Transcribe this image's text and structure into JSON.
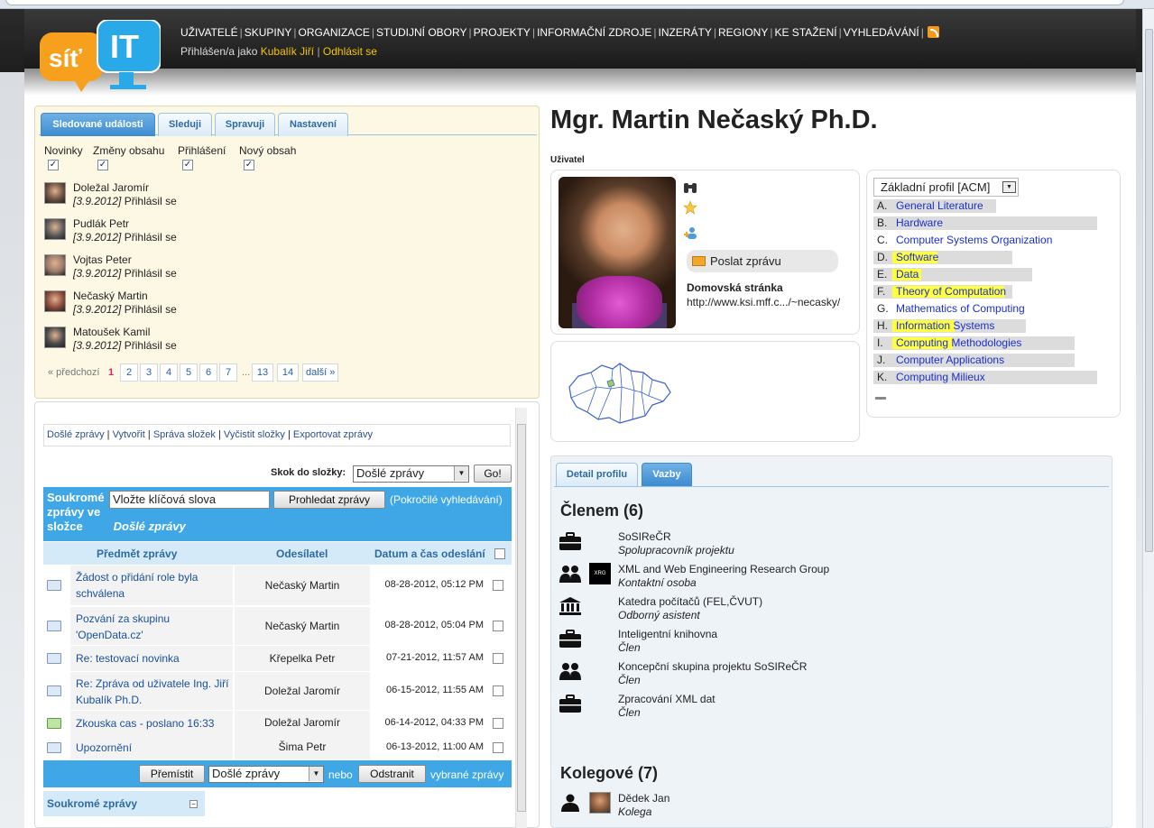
{
  "header": {
    "logo_text_left": "síť",
    "logo_text_right": "IT",
    "nav": [
      "UŽIVATELÉ",
      "SKUPINY",
      "ORGANIZACE",
      "STUDIJNÍ OBORY",
      "PROJEKTY",
      "INFORMAČNÍ ZDROJE",
      "INZERÁTY",
      "REGIONY",
      "KE STAŽENÍ",
      "VYHLEDÁVÁNÍ"
    ],
    "logged_prefix": "Přihlášen/a jako",
    "logged_user": "Kubalík Jiří",
    "logout": "Odhlásit se"
  },
  "left": {
    "tabs": [
      "Sledované události",
      "Sleduji",
      "Spravuji",
      "Nastavení"
    ],
    "filters": [
      "Novinky",
      "Změny obsahu",
      "Přihlášení",
      "Nový obsah"
    ],
    "events": [
      {
        "name": "Doležal Jaromír",
        "date": "[3.9.2012]",
        "action": "Přihlásil se"
      },
      {
        "name": "Pudlák Petr",
        "date": "[3.9.2012]",
        "action": "Přihlásil se"
      },
      {
        "name": "Vojtas Peter",
        "date": "[3.9.2012]",
        "action": "Přihlásil se"
      },
      {
        "name": "Nečaský Martin",
        "date": "[3.9.2012]",
        "action": "Přihlásil se"
      },
      {
        "name": "Matoušek Kamil",
        "date": "[3.9.2012]",
        "action": "Přihlásil se"
      }
    ],
    "pager": {
      "prev": "« předchozí",
      "current": "1",
      "pages": [
        "2",
        "3",
        "4",
        "5",
        "6",
        "7"
      ],
      "ellipsis": "...",
      "pages_end": [
        "13",
        "14"
      ],
      "next": "další »"
    }
  },
  "messages": {
    "tools": [
      "Došlé zprávy",
      "Vytvořit",
      "Správa složek",
      "Vyčistit složky",
      "Exportovat zprávy"
    ],
    "jump_label": "Skok do složky:",
    "jump_value": "Došlé zprávy",
    "go": "Go!",
    "box_title_1": "Soukromé zprávy ve složce",
    "box_title_folder": "Došlé zprávy",
    "search_value": "Vložte klíčová slova",
    "search_button": "Prohledat zprávy",
    "advanced": "(Pokročilé vyhledávání)",
    "columns": {
      "subject": "Předmět zprávy",
      "sender": "Odesílatel",
      "date": "Datum a čas odeslání"
    },
    "rows": [
      {
        "subject": "Žádost o přidání role byla schválena",
        "sender": "Nečaský Martin",
        "date": "08-28-2012, 05:12 PM"
      },
      {
        "subject": "Pozvání za skupinu 'OpenData.cz'",
        "sender": "Nečaský Martin",
        "date": "08-28-2012, 05:04 PM"
      },
      {
        "subject": "Re: testovací novinka",
        "sender": "Křepelka Petr",
        "date": "07-21-2012, 11:57 AM"
      },
      {
        "subject": "Re: Zpráva od uživatele Ing. Jiří Kubalík Ph.D.",
        "sender": "Doležal Jaromír",
        "date": "06-15-2012, 11:55 AM"
      },
      {
        "subject": "Zkouska cas - poslano 16:33",
        "sender": "Doležal Jaromír",
        "date": "06-14-2012, 04:33 PM"
      },
      {
        "subject": "Upozornění",
        "sender": "Šima Petr",
        "date": "06-13-2012, 11:00 AM"
      }
    ],
    "move_button": "Přemístit",
    "move_folder": "Došlé zprávy",
    "or": "nebo",
    "delete_button": "Odstranit",
    "selected": "vybrané zprávy",
    "private_box": "Soukromé zprávy"
  },
  "profile": {
    "name": "Mgr. Martin Nečaský Ph.D.",
    "type": "Uživatel",
    "send_message": "Poslat zprávu",
    "homepage_label": "Domovská stránka",
    "homepage_url": "http://www.ksi.mff.c.../~necasky/",
    "acm_select": "Základní profil [ACM]",
    "acm": [
      {
        "letter": "A.",
        "text": "General Literature",
        "bar": 0.55,
        "hl": 0
      },
      {
        "letter": "B.",
        "text": "Hardware",
        "bar": 1.0,
        "hl": 0
      },
      {
        "letter": "C.",
        "text": "Computer Systems Organization",
        "bar": 0.0,
        "hl": 0
      },
      {
        "letter": "D.",
        "text": "Software",
        "bar": 0.62,
        "hl": 0.2
      },
      {
        "letter": "E.",
        "text": "Data",
        "bar": 0.71,
        "hl": 0.13
      },
      {
        "letter": "F.",
        "text": "Theory of Computation",
        "bar": 0.62,
        "hl": 0.5
      },
      {
        "letter": "G.",
        "text": "Mathematics of Computing",
        "bar": 0.0,
        "hl": 0
      },
      {
        "letter": "H.",
        "text": "Information Systems",
        "bar": 0.68,
        "hl": 0.28
      },
      {
        "letter": "I.",
        "text": "Computing Methodologies",
        "bar": 0.9,
        "hl": 0.27
      },
      {
        "letter": "J.",
        "text": "Computer Applications",
        "bar": 0.9,
        "hl": 0
      },
      {
        "letter": "K.",
        "text": "Computing Milieux",
        "bar": 1.0,
        "hl": 0
      }
    ],
    "tabs": [
      "Detail profilu",
      "Vazby"
    ],
    "member_heading": "Členem (6)",
    "memberships": [
      {
        "icon": "briefcase-icon",
        "name": "SoSIReČR",
        "role": "Spolupracovník projektu"
      },
      {
        "icon": "group-icon",
        "name": "XML and Web Engineering Research Group",
        "role": "Kontaktní osoba",
        "badge": "XRG"
      },
      {
        "icon": "institution-icon",
        "name": "Katedra počítačů (FEL,ČVUT)",
        "role": "Odborný asistent"
      },
      {
        "icon": "briefcase-icon",
        "name": "Inteligentní knihovna",
        "role": "Člen"
      },
      {
        "icon": "group-icon",
        "name": "Koncepční skupina projektu SoSIReČR",
        "role": "Člen"
      },
      {
        "icon": "briefcase-icon",
        "name": "Zpracování XML dat",
        "role": "Člen"
      }
    ],
    "colleagues_heading": "Kolegové (7)",
    "colleague": {
      "name": "Dědek Jan",
      "role": "Kolega"
    }
  }
}
